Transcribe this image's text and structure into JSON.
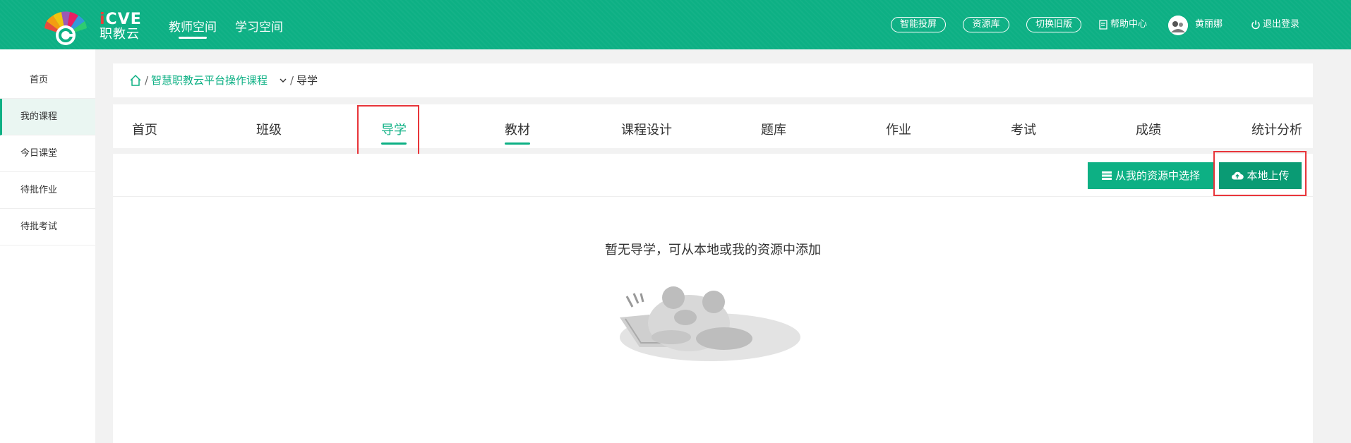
{
  "header": {
    "logo": {
      "en_prefix": "i",
      "en_rest": "CVE",
      "cn": "职教云"
    },
    "nav": [
      {
        "label": "教师空间",
        "active": true
      },
      {
        "label": "学习空间",
        "active": false
      }
    ],
    "pills": [
      "智能投屏",
      "资源库",
      "切换旧版"
    ],
    "help": "帮助中心",
    "user": "黄丽娜",
    "logout": "退出登录",
    "icons": {
      "help": "doc-icon",
      "logout": "power-icon"
    }
  },
  "sidebar": {
    "items": [
      {
        "label": "首页",
        "active": false
      },
      {
        "label": "我的课程",
        "active": true
      },
      {
        "label": "今日课堂",
        "active": false
      },
      {
        "label": "待批作业",
        "active": false
      },
      {
        "label": "待批考试",
        "active": false
      }
    ]
  },
  "breadcrumb": {
    "course": "智慧职教云平台操作课程",
    "current": "导学",
    "separator": "/"
  },
  "tabs": [
    {
      "label": "首页"
    },
    {
      "label": "班级"
    },
    {
      "label": "导学",
      "active": true
    },
    {
      "label": "教材",
      "underlined": true
    },
    {
      "label": "课程设计"
    },
    {
      "label": "题库"
    },
    {
      "label": "作业"
    },
    {
      "label": "考试"
    },
    {
      "label": "成绩"
    },
    {
      "label": "统计分析"
    }
  ],
  "toolbar": {
    "select_resource": "从我的资源中选择",
    "local_upload": "本地上传"
  },
  "empty": {
    "message": "暂无导学，可从本地或我的资源中添加"
  },
  "colors": {
    "brand": "#0db084",
    "highlight": "#e8353a"
  }
}
